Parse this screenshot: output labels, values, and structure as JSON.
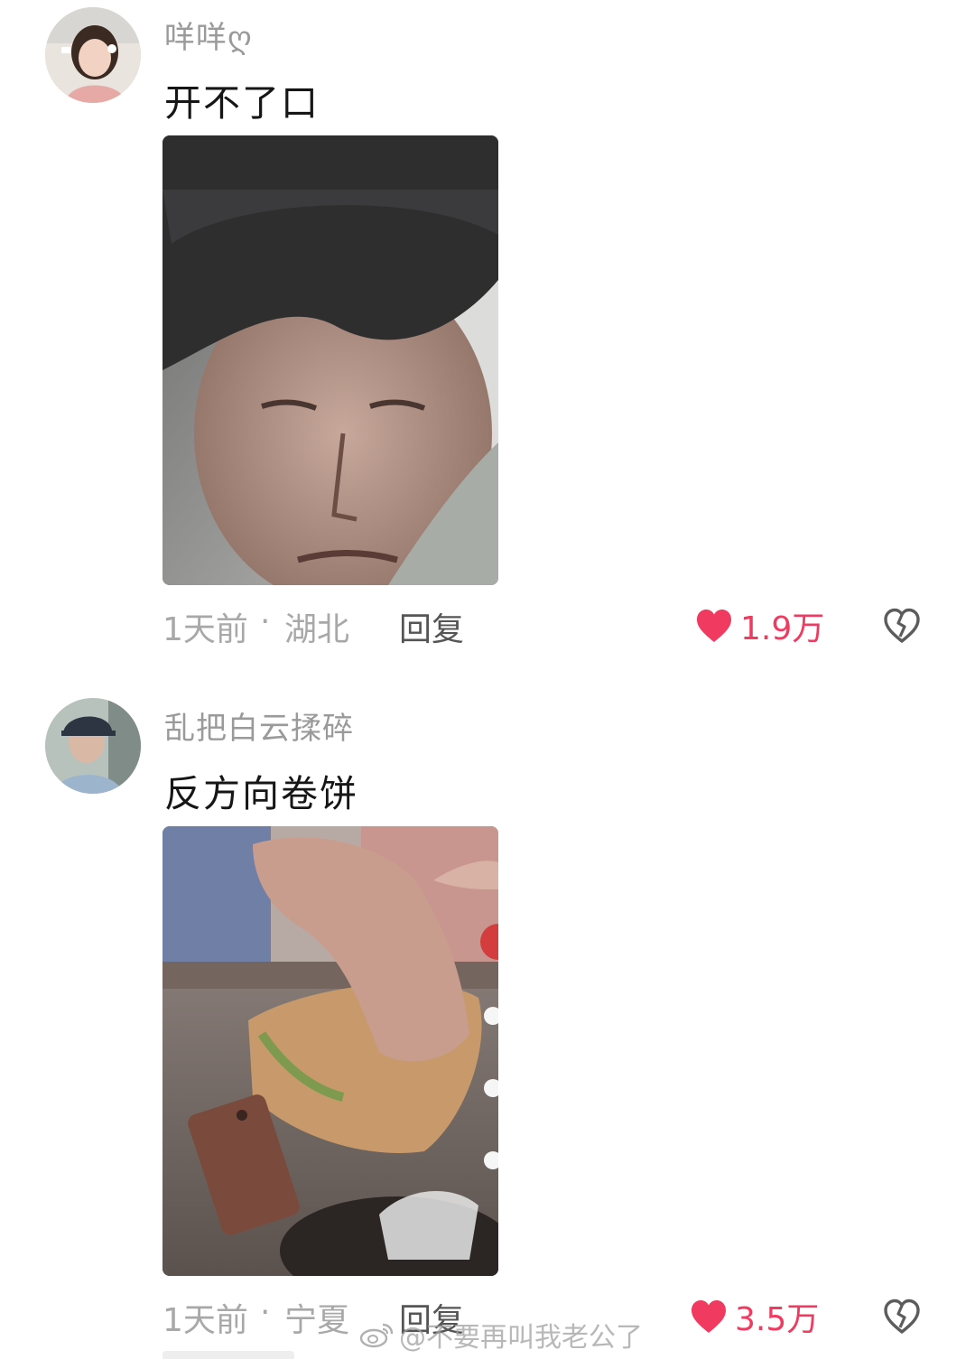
{
  "comments": [
    {
      "username": "咩咩ღ",
      "text": "开不了口",
      "time": "1天前",
      "dot": "·",
      "location": "湖北",
      "reply_label": "回复",
      "likes": "1.9万"
    },
    {
      "username": "乱把白云揉碎",
      "text": "反方向卷饼",
      "time": "1天前",
      "dot": "·",
      "location": "宁夏",
      "reply_label": "回复",
      "likes": "3.5万"
    }
  ],
  "watermark": {
    "text": "@不要再叫我老公了"
  },
  "colors": {
    "like_accent": "#f03a5f",
    "meta_text": "#a8a8a8",
    "reply_text": "#555555",
    "username_text": "#9a9a9a"
  },
  "icons": {
    "like": "heart-icon",
    "dislike": "broken-heart-icon",
    "watermark": "weibo-icon"
  }
}
